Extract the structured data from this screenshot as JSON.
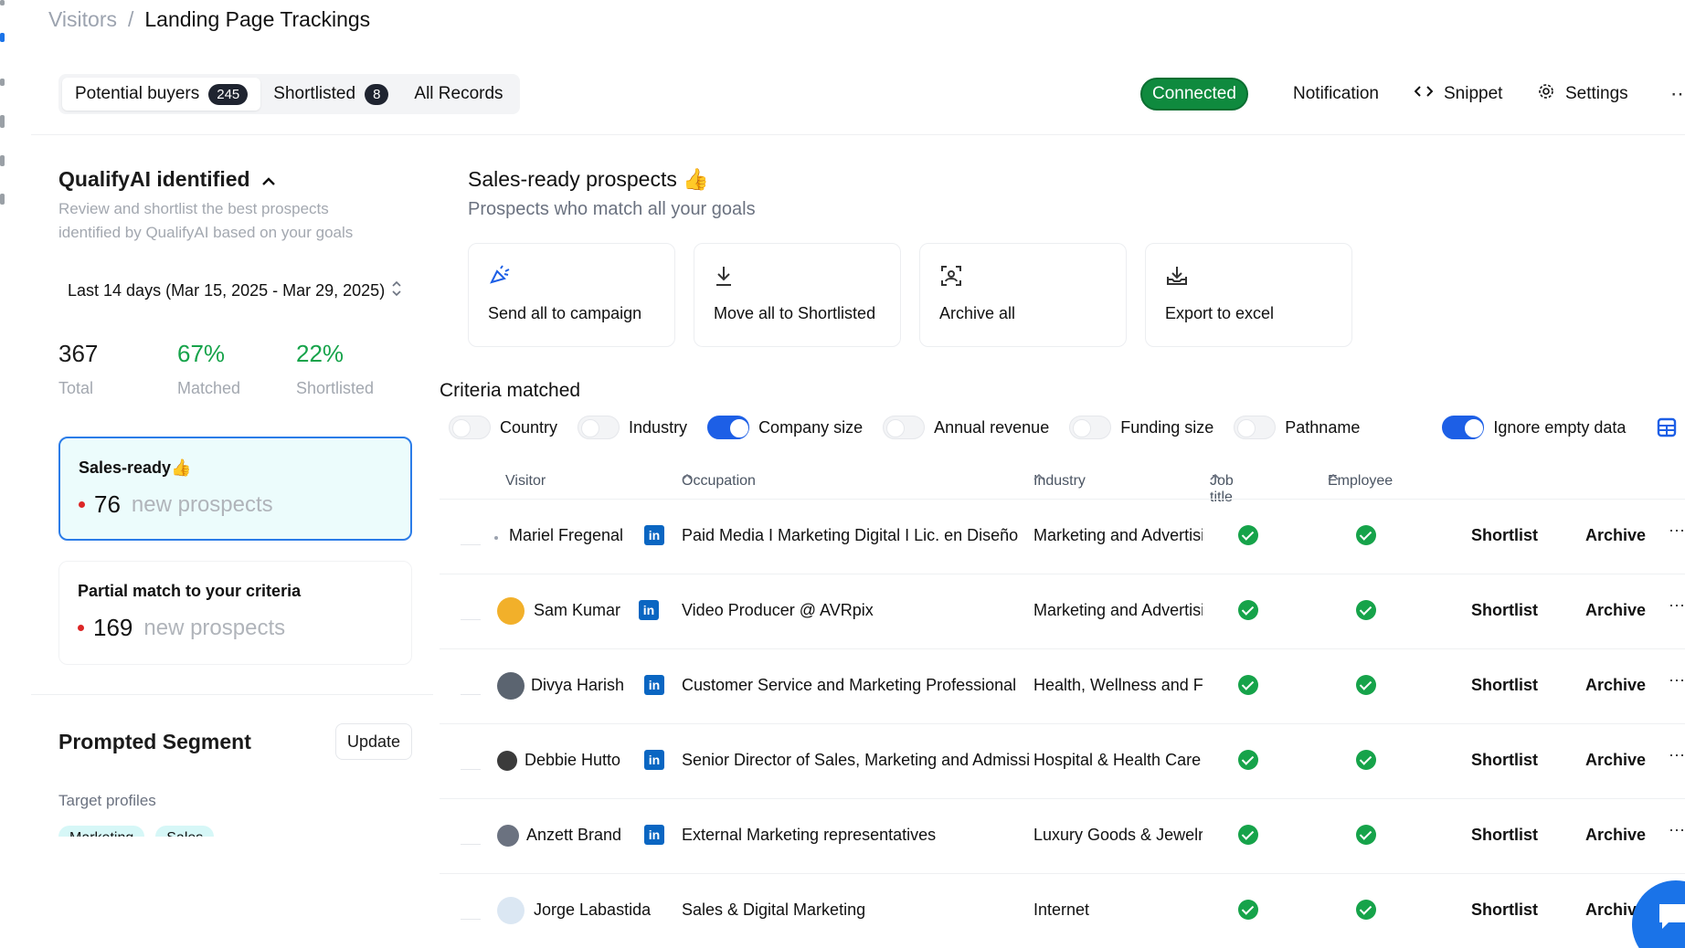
{
  "breadcrumb": {
    "parent": "Visitors",
    "separator": "/",
    "current": "Landing Page Trackings"
  },
  "tabs": [
    {
      "label": "Potential buyers",
      "count": "245",
      "active": true
    },
    {
      "label": "Shortlisted",
      "count": "8",
      "active": false
    },
    {
      "label": "All Records",
      "count": "",
      "active": false
    }
  ],
  "header": {
    "status": "Connected",
    "notification": "Notification",
    "snippet": "Snippet",
    "settings": "Settings"
  },
  "left_panel": {
    "title": "QualifyAI identified",
    "subtitle": "Review and shortlist the best prospects identified by QualifyAI based on your goals",
    "date_range": "Last 14 days (Mar 15, 2025 - Mar 29, 2025)",
    "stats": [
      {
        "value": "367",
        "label": "Total"
      },
      {
        "value": "67%",
        "label": "Matched"
      },
      {
        "value": "22%",
        "label": "Shortlisted"
      }
    ],
    "cards": [
      {
        "title": "Sales-ready👍",
        "count": "76",
        "note": "new prospects"
      },
      {
        "title": "Partial match to your criteria",
        "count": "169",
        "note": "new prospects"
      }
    ],
    "segment": {
      "title": "Prompted Segment",
      "update_label": "Update",
      "target_label": "Target profiles",
      "tags": [
        "Marketing",
        "Sales"
      ]
    }
  },
  "main": {
    "title": "Sales-ready prospects 👍",
    "subtitle": "Prospects who match all your goals",
    "actions": [
      {
        "label": "Send all to campaign",
        "icon": "campaign-icon"
      },
      {
        "label": "Move all to Shortlisted",
        "icon": "download-icon"
      },
      {
        "label": "Archive all",
        "icon": "archive-icon"
      },
      {
        "label": "Export to excel",
        "icon": "export-icon"
      }
    ],
    "criteria_title": "Criteria matched",
    "filters": [
      {
        "label": "Country",
        "on": false
      },
      {
        "label": "Industry",
        "on": false
      },
      {
        "label": "Company size",
        "on": true
      },
      {
        "label": "Annual revenue",
        "on": false
      },
      {
        "label": "Funding size",
        "on": false
      },
      {
        "label": "Pathname",
        "on": false
      }
    ],
    "ignore_empty": {
      "label": "Ignore empty data",
      "on": true
    },
    "columns": {
      "visitor": "Visitor",
      "occupation": "Occupation",
      "industry": "Industry",
      "job_title": "Job title",
      "employee": "Employee"
    },
    "row_actions": {
      "shortlist": "Shortlist",
      "archive": "Archive"
    },
    "rows": [
      {
        "name": "Mariel Fregenal",
        "occupation": "Paid Media I Marketing Digital I Lic. en Diseño",
        "industry": "Marketing and Advertising"
      },
      {
        "name": "Sam Kumar",
        "occupation": "Video Producer @ AVRpix",
        "industry": "Marketing and Advertising"
      },
      {
        "name": "Divya Harish",
        "occupation": "Customer Service and Marketing Professional",
        "industry": "Health, Wellness and Fitness"
      },
      {
        "name": "Debbie Hutto",
        "occupation": "Senior Director of Sales, Marketing and Admissions",
        "industry": "Hospital & Health Care"
      },
      {
        "name": "Anzett Brand",
        "occupation": "External Marketing representatives",
        "industry": "Luxury Goods & Jewelry"
      },
      {
        "name": "Jorge Labastida",
        "occupation": "Sales & Digital Marketing",
        "industry": "Internet"
      }
    ]
  },
  "colors": {
    "accent": "#1d5fe6",
    "success": "#16a34a",
    "connected": "#0f8a3e",
    "selected_card_bg": "#ecfcfc"
  }
}
